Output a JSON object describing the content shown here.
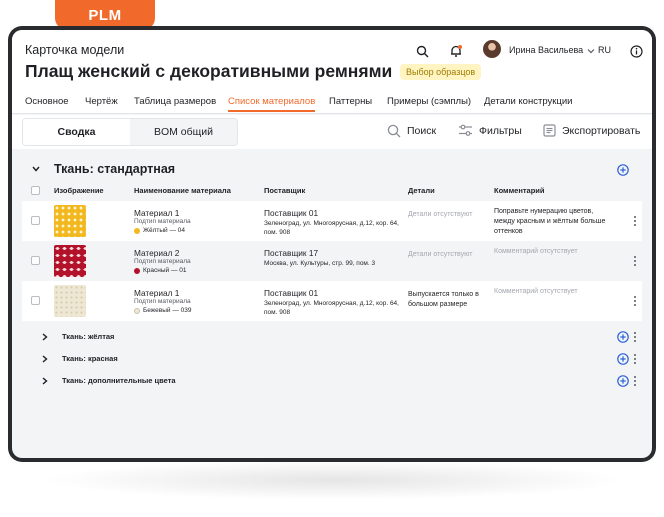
{
  "brand": {
    "label": "PLM",
    "accent": "#f26a2b"
  },
  "header": {
    "subtitle": "Карточка модели",
    "title": "Плащ женский с декоративными ремнями",
    "badge": "Выбор образцов",
    "user_name": "Ирина Васильева",
    "language": "RU",
    "icons": [
      "search-icon",
      "notification-icon",
      "chevron-down-icon",
      "info-icon"
    ]
  },
  "tabs": [
    {
      "label": "Основное"
    },
    {
      "label": "Чертёж"
    },
    {
      "label": "Таблица размеров"
    },
    {
      "label": "Список материалов",
      "active": true
    },
    {
      "label": "Паттерны"
    },
    {
      "label": "Примеры (сэмплы)"
    },
    {
      "label": "Детали конструкции"
    }
  ],
  "toolbar": {
    "segments": [
      {
        "label": "Сводка",
        "active": true
      },
      {
        "label": "BOM общий"
      }
    ],
    "search_label": "Поиск",
    "filters_label": "Фильтры",
    "export_label": "Экспортировать"
  },
  "section": {
    "title": "Ткань: стандартная",
    "columns": [
      "Изображение",
      "Наименование материала",
      "Поставщик",
      "Детали",
      "Комментарий"
    ],
    "rows": [
      {
        "material": "Материал 1",
        "material_sub": "Подтип материала",
        "color_name": "Жёлтый — 04",
        "color": "#f2b81f",
        "supplier": "Поставщик 01",
        "address": "Зеленоград, ул. Многоярусная, д.12, кор. 64, пом. 908",
        "details": "Детали отсутствуют",
        "details_muted": true,
        "comment": "Поправьте нумерацию цветов, между красным и жёлтым больше оттенков",
        "comment_muted": false
      },
      {
        "material": "Материал 2",
        "material_sub": "Подтип материала",
        "color_name": "Красный — 01",
        "color": "#b3122b",
        "supplier": "Поставщик 17",
        "address": "Москва, ул. Культуры, стр. 99, пом. 3",
        "details": "Детали отсутствуют",
        "details_muted": true,
        "comment": "Комментарий отсутствует",
        "comment_muted": true
      },
      {
        "material": "Материал 1",
        "material_sub": "Подтип материала",
        "color_name": "Бежевый — 039",
        "color": "#eee7d3",
        "supplier": "Поставщик 01",
        "address": "Зеленоград, ул. Многоярусная, д.12, кор. 64, пом. 908",
        "details": "Выпускается только в большом размере",
        "details_muted": false,
        "comment": "Комментарий отсутствует",
        "comment_muted": true
      }
    ]
  },
  "groups": [
    {
      "label": "Ткань: жёлтая"
    },
    {
      "label": "Ткань: красная"
    },
    {
      "label": "Ткань: дополнительные цвета"
    }
  ]
}
